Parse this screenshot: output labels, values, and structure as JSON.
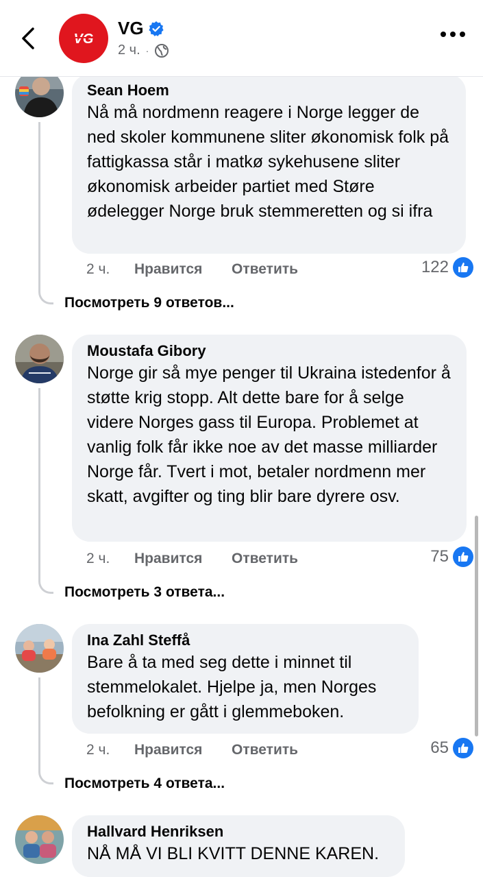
{
  "header": {
    "back_icon": "chevron-left-icon",
    "page_logo_text": "VG",
    "page_name": "VG",
    "post_time": "2 ч.",
    "audience_icon": "globe-icon",
    "more_icon": "more-dots-icon"
  },
  "comments": [
    {
      "author": "Sean Hoem",
      "text": "Nå må nordmenn reagere i Norge legger de ned skoler kommunene sliter økonomisk folk på fattigkassa står i matkø sykehusene sliter økonomisk arbeider partiet med Støre ødelegger Norge bruk stemmeretten og si ifra",
      "time": "2 ч.",
      "like_label": "Нравится",
      "reply_label": "Ответить",
      "reaction_count": "122",
      "view_replies": "Посмотреть 9 ответов..."
    },
    {
      "author": "Moustafa Gibory",
      "text": "Norge gir så mye penger til Ukraina istedenfor å støtte krig stopp. Alt dette bare for å selge videre Norges gass til Europa. Problemet at vanlig folk får ikke noe av det masse milliarder Norge får. Tvert i mot, betaler nordmenn mer skatt, avgifter og ting blir bare dyrere osv.",
      "time": "2 ч.",
      "like_label": "Нравится",
      "reply_label": "Ответить",
      "reaction_count": "75",
      "view_replies": "Посмотреть 3 ответа..."
    },
    {
      "author": "Ina Zahl Steffå",
      "text": "Bare å ta med seg dette i minnet til stemmelokalet. Hjelpe ja, men Norges befolkning er gått i glemmeboken.",
      "time": "2 ч.",
      "like_label": "Нравится",
      "reply_label": "Ответить",
      "reaction_count": "65",
      "view_replies": "Посмотреть 4 ответа..."
    },
    {
      "author": "Hallvard Henriksen",
      "text": "NÅ MÅ VI BLI KVITT DENNE KAREN."
    }
  ],
  "colors": {
    "brand_red": "#e0161e",
    "verified_blue": "#1877f2",
    "bubble_bg": "#f0f2f5",
    "secondary_text": "#65676b"
  }
}
